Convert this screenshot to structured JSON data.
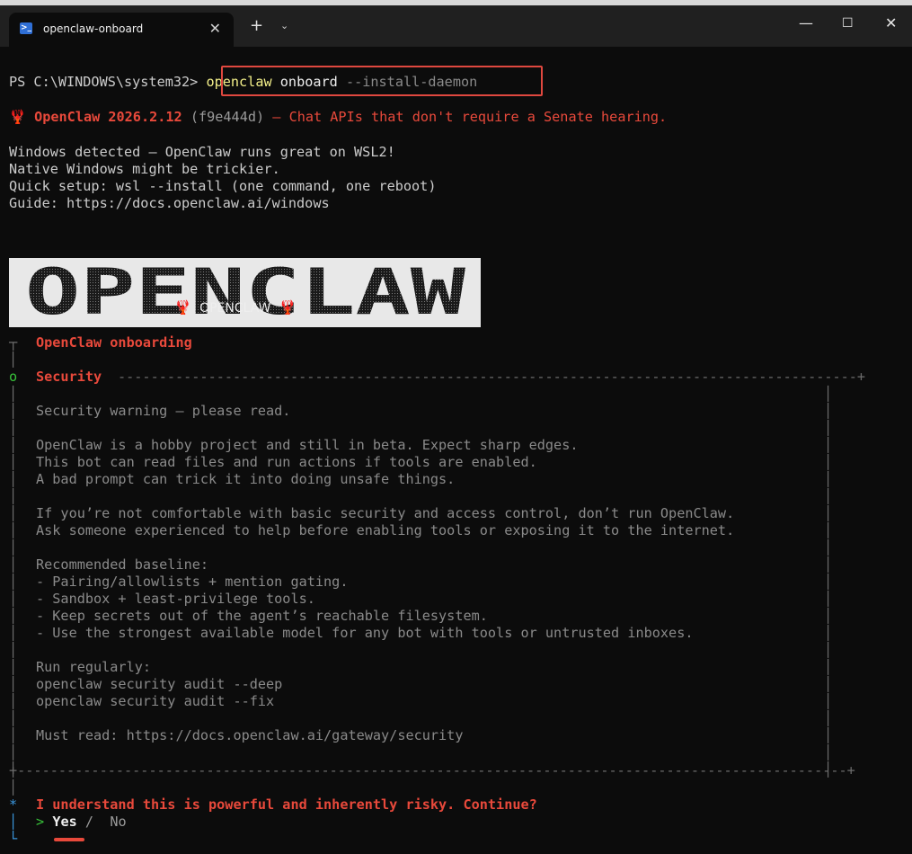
{
  "window": {
    "tab_title": "openclaw-onboard",
    "tab_icon": "powershell-icon",
    "new_tab": "+",
    "dropdown": "⌄",
    "minimize": "—",
    "maximize": "☐",
    "close": "✕",
    "tab_close": "✕"
  },
  "terminal": {
    "prompt": "PS C:\\WINDOWS\\system32>",
    "command_name": "openclaw",
    "command_sub": "onboard",
    "command_flag": "--install-daemon",
    "banner_icon": "🦞",
    "banner_name": "OpenClaw 2026.2.12",
    "banner_hash": "(f9e444d)",
    "banner_tagline": "– Chat APIs that don't require a Senate hearing.",
    "windows_lines": [
      "Windows detected – OpenClaw runs great on WSL2!",
      "Native Windows might be trickier.",
      "Quick setup: wsl --install (one command, one reboot)",
      "Guide: https://docs.openclaw.ai/windows"
    ],
    "logo_text": "OPENCLAW",
    "logo_caption_icon": "🦞",
    "logo_caption": "OPENCLAW",
    "onboarding_title": "OpenClaw onboarding",
    "security_title": "Security",
    "security_lines": [
      "Security warning – please read.",
      "",
      "OpenClaw is a hobby project and still in beta. Expect sharp edges.",
      "This bot can read files and run actions if tools are enabled.",
      "A bad prompt can trick it into doing unsafe things.",
      "",
      "If you’re not comfortable with basic security and access control, don’t run OpenClaw.",
      "Ask someone experienced to help before enabling tools or exposing it to the internet.",
      "",
      "Recommended baseline:",
      "- Pairing/allowlists + mention gating.",
      "- Sandbox + least-privilege tools.",
      "- Keep secrets out of the agent’s reachable filesystem.",
      "- Use the strongest available model for any bot with tools or untrusted inboxes.",
      "",
      "Run regularly:",
      "openclaw security audit --deep",
      "openclaw security audit --fix",
      "",
      "Must read: https://docs.openclaw.ai/gateway/security"
    ],
    "question": "I understand this is powerful and inherently risky. Continue?",
    "option_yes": "Yes",
    "option_separator": "/",
    "option_no": "No",
    "cursor": ">"
  },
  "colors": {
    "accent_red": "#e8493b",
    "terminal_bg": "#0c0c0c",
    "highlight_box": "#e0483f"
  }
}
